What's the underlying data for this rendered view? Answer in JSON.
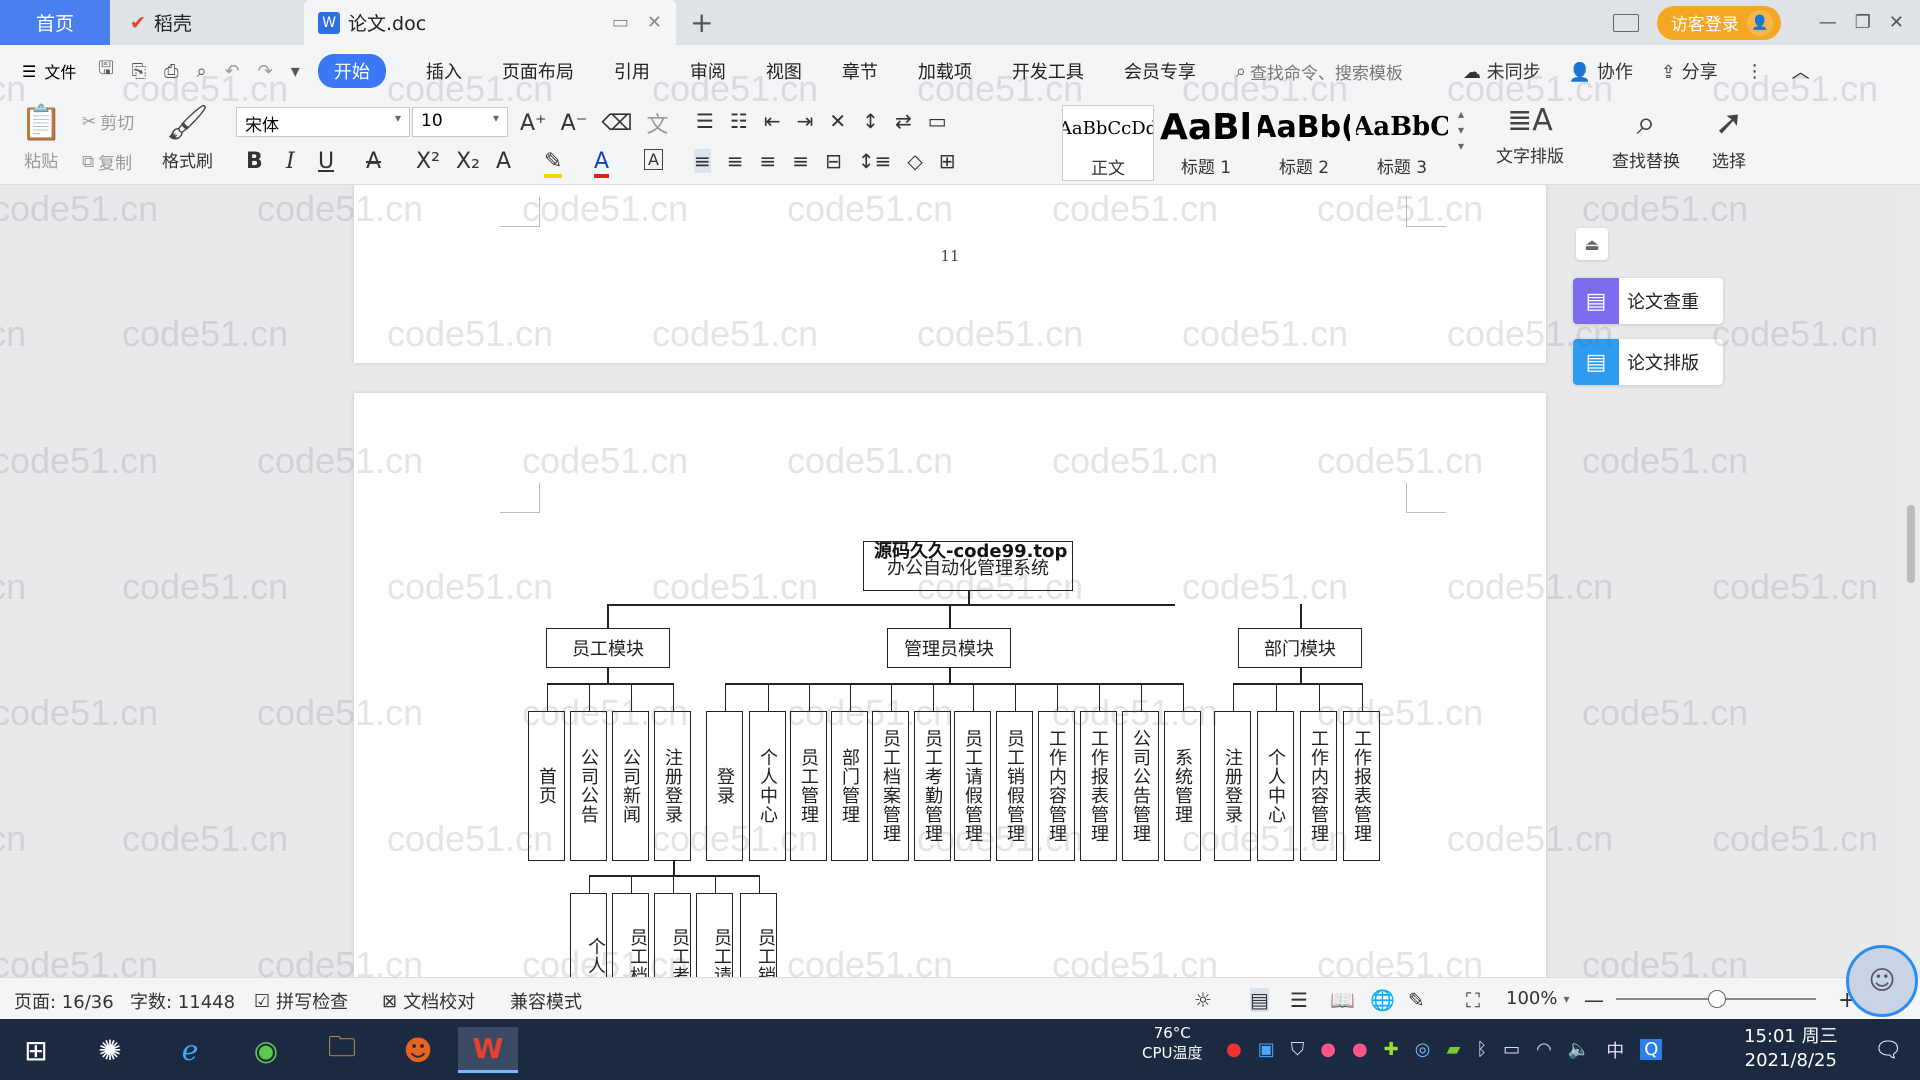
{
  "tabs": {
    "home": "首页",
    "daoke": "稻壳",
    "doc": "论文.doc"
  },
  "titlebar": {
    "login": "访客登录"
  },
  "menu": {
    "file": "文件",
    "start": "开始",
    "insert": "插入",
    "layout": "页面布局",
    "reference": "引用",
    "review": "审阅",
    "view": "视图",
    "chapter": "章节",
    "addons": "加载项",
    "devtools": "开发工具",
    "vip": "会员专享",
    "search_placeholder": "查找命令、搜索模板",
    "sync": "未同步",
    "collab": "协作",
    "share": "分享"
  },
  "ribbon": {
    "paste": "粘贴",
    "cut": "剪切",
    "copy": "复制",
    "format_painter": "格式刷",
    "font_name": "宋体",
    "font_size": "10",
    "styles": [
      {
        "preview": "AaBbCcDd",
        "name": "正文"
      },
      {
        "preview": "AaBl",
        "name": "标题 1"
      },
      {
        "preview": "AaBb(",
        "name": "标题 2"
      },
      {
        "preview": "AaBbC",
        "name": "标题 3"
      }
    ],
    "text_layout": "文字排版",
    "find_replace": "查找替换",
    "select": "选择"
  },
  "document": {
    "page_number": "11",
    "chart": {
      "watermark_title": "源码久久-code99.top",
      "root": "办公自动化管理系统",
      "modules": [
        "员工模块",
        "管理员模块",
        "部门模块"
      ],
      "employee_children": [
        "首页",
        "公司公告",
        "公司新闻",
        "注册登录"
      ],
      "admin_children": [
        "登录",
        "个人中心",
        "员工管理",
        "部门管理",
        "员工档案管理",
        "员工考勤管理",
        "员工请假管理",
        "员工销假管理",
        "工作内容管理",
        "工作报表管理",
        "公司公告管理",
        "系统管理"
      ],
      "dept_children": [
        "注册登录",
        "个人中心",
        "工作内容管理",
        "工作报表管理"
      ],
      "sub_children": [
        "个人",
        "员工档",
        "员工考",
        "员工请",
        "员工销"
      ]
    }
  },
  "side_panel": {
    "check": "论文查重",
    "format": "论文排版"
  },
  "statusbar": {
    "page": "页面: 16/36",
    "words": "字数: 11448",
    "spell": "拼写检查",
    "proof": "文档校对",
    "compat": "兼容模式",
    "zoom": "100%"
  },
  "taskbar": {
    "cpu_temp": "76°C",
    "cpu_label": "CPU温度",
    "ime": "中",
    "time": "15:01 周三",
    "date": "2021/8/25"
  },
  "watermark_text": "code51.cn"
}
